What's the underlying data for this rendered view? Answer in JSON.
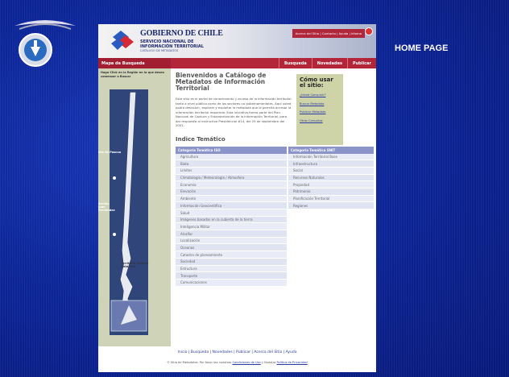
{
  "slide": {
    "home_label": "HOME PAGE"
  },
  "header": {
    "title": "GOBIERNO DE CHILE",
    "subtitle": "SERVICIO NACIONAL DE INFORMACIÓN TERRITORIAL",
    "tagline": "CATÁLOGO DE METADATOS",
    "top_links": "Acerca del Sitio | Contacto | Ayuda | Idioma"
  },
  "nav": {
    "mapa": "Mapa de Busqueda",
    "items": [
      "Busqueda",
      "Novedades",
      "Publicar"
    ]
  },
  "left": {
    "hint": "Haga Click en la Región en la que desea comenzar a Buscar",
    "islands": [
      "Isla de Pascua",
      "Archip. Juan Fernández",
      "Territorio Chileno Antártico"
    ]
  },
  "main": {
    "welcome": "Bienvenidos a Catálogo de Metadatos de Información Territorial",
    "intro": "Este sitio es el portal de conocimiento y acceso de la información territorial tanto a nivel público como de los sectores no gubernamentales. Aquí usted podrá descubrir, explorar y exploitar la metadata que le permita accesar la información territorial requerida. Esta iniciativa forma parte del Plan Nacional de Captura y Estandarización de la Información Territorial, para dar respuesta al instructivo Presidencial #14, del 25 de septiembre del 2001.",
    "howto": {
      "title": "Cómo usar el sitio:",
      "links": [
        "¿Usted Consumir?",
        "Buscar Metadata",
        "Publicar Metadata",
        "Otras Consultas"
      ]
    }
  },
  "index": {
    "title": "Indice Temático",
    "iso_header": "Categoría Temática ISO",
    "snit_header": "Categoría Temática SNIT",
    "iso_items": [
      "Agricultura",
      "Biota",
      "Límites",
      "Climatología / Meteorología / Atmosfera",
      "Economía",
      "Elevación",
      "Ambiente",
      "Información Geocientífica",
      "Salud",
      "Imágenes basadas en la cubierta de la tierra",
      "Inteligencia Militar",
      "Alcalfar",
      "Localización",
      "Oceanos",
      "Catastro de planeamiento",
      "Sociedad",
      "Estructura",
      "Transporte",
      "Comunicaciones"
    ],
    "snit_items": [
      "Información Territorial Base",
      "Infraestructura",
      "Social",
      "Recursos Naturales",
      "Propiedad",
      "Patrimonio",
      "Planificación Territorial",
      "Regiones"
    ]
  },
  "footer": {
    "links": "Inicio | Busqueda | Novedades | Publicar | Acerca del Sitio | Ayuda",
    "copy_prefix": "© Sitio de Metadatos. Por favor lea nuestras",
    "terms": "Condiciones de Uso",
    "and": "y Nuestra",
    "privacy": "Política de Privacidad"
  },
  "colors": {
    "slide_bg": "#0d2699",
    "nav_red": "#b3263a",
    "column_header": "#8a94c8",
    "left_panel": "#cfd4b8"
  }
}
